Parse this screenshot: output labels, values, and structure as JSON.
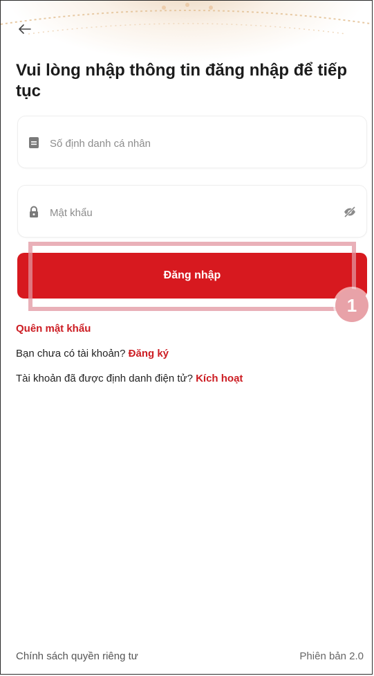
{
  "header": {
    "back_icon": "arrow-left-icon"
  },
  "page_title": "Vui lòng nhập thông tin đăng nhập để tiếp tục",
  "form": {
    "id_field": {
      "placeholder": "Số định danh cá nhân",
      "value": "",
      "icon": "id-card-icon"
    },
    "password_field": {
      "placeholder": "Mật khẩu",
      "value": "",
      "icon": "lock-icon",
      "toggle_icon": "eye-off-icon"
    },
    "login_label": "Đăng nhập"
  },
  "annotation": {
    "step_number": "1",
    "highlight_color": "#e8a2a8"
  },
  "links": {
    "forgot_password": "Quên mật khẩu",
    "register_prompt": "Bạn chưa có tài khoản? ",
    "register_link": "Đăng ký",
    "activate_prompt": "Tài khoản đã được định danh điện tử? ",
    "activate_link": "Kích hoạt"
  },
  "footer": {
    "privacy": "Chính sách quyền riêng tư",
    "version": "Phiên bản 2.0"
  },
  "colors": {
    "brand_red": "#d7191f",
    "link_red": "#cc1c22"
  }
}
